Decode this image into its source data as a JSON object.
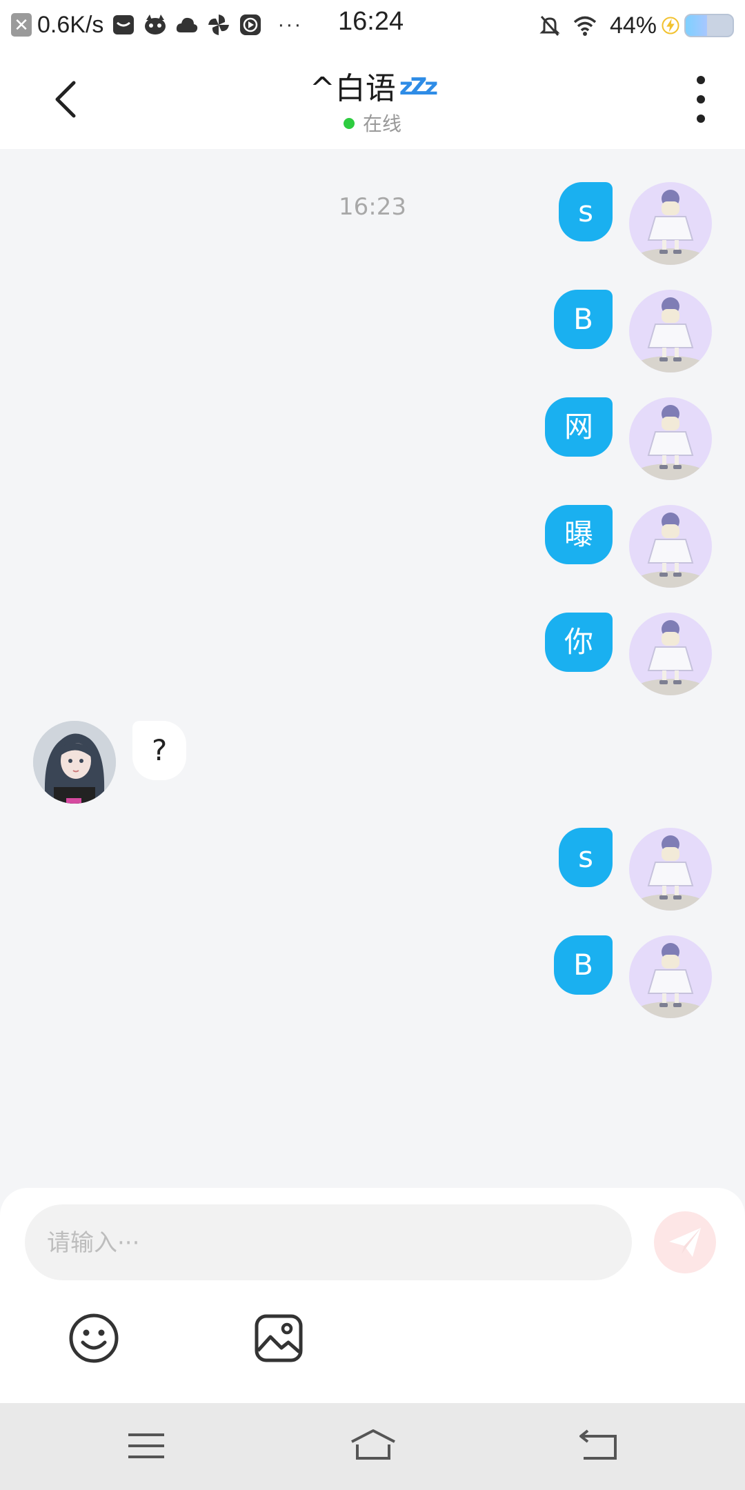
{
  "status_bar": {
    "net_speed": "0.6K/s",
    "time": "16:24",
    "battery": "44%",
    "more": "···",
    "icons": [
      "close-notification-icon",
      "inbox-icon",
      "cat-app-icon",
      "cloud-icon",
      "pinwheel-icon",
      "play-icon",
      "mute-bell-icon",
      "wifi-icon",
      "charging-icon",
      "battery-icon"
    ]
  },
  "header": {
    "title": "^白语",
    "title_decoration": "zZz",
    "status": "在线",
    "status_color": "#2ecc40"
  },
  "chat": {
    "timestamp": "16:23",
    "messages": [
      {
        "from": "me",
        "text": "s"
      },
      {
        "from": "me",
        "text": "B"
      },
      {
        "from": "me",
        "text": "网"
      },
      {
        "from": "me",
        "text": "曝"
      },
      {
        "from": "me",
        "text": "你"
      },
      {
        "from": "other",
        "text": "?"
      },
      {
        "from": "me",
        "text": "s"
      },
      {
        "from": "me",
        "text": "B"
      }
    ]
  },
  "composer": {
    "placeholder": "请输入···",
    "value": ""
  },
  "colors": {
    "bubble_out": "#1ab0f0",
    "bubble_in": "#ffffff",
    "background": "#f4f5f7",
    "send_button": "#fde6e6"
  }
}
